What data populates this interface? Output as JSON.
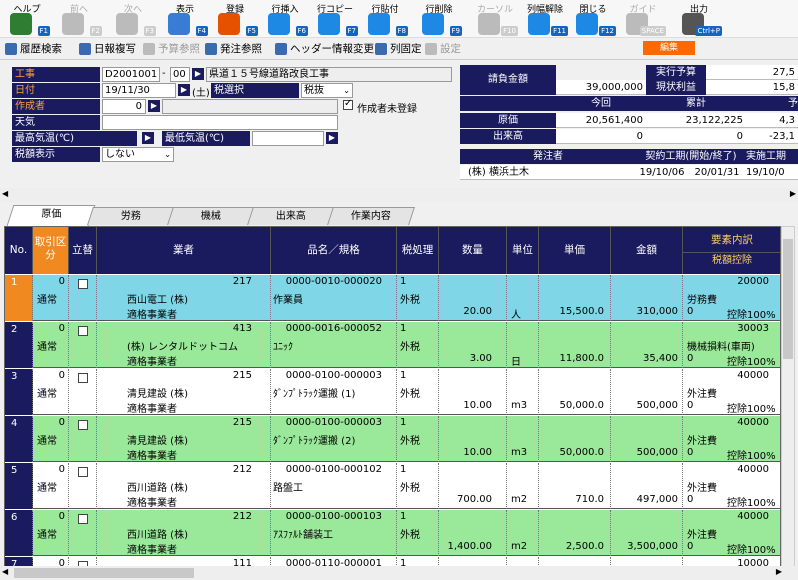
{
  "toolbar": [
    {
      "label": "ヘルプ",
      "key": "F1",
      "icon": "help-icon",
      "color": "#2e7d32",
      "dis": false
    },
    {
      "label": "前へ",
      "key": "F2",
      "icon": "arrow-left-icon",
      "color": "#bbb",
      "dis": true
    },
    {
      "label": "次へ",
      "key": "F3",
      "icon": "arrow-right-icon",
      "color": "#bbb",
      "dis": true
    },
    {
      "label": "表示",
      "key": "F4",
      "icon": "search-icon",
      "color": "#3a7bd5",
      "dis": false
    },
    {
      "label": "登録",
      "key": "F5",
      "icon": "ok-icon",
      "color": "#e65100",
      "dis": false
    },
    {
      "label": "行挿入",
      "key": "F6",
      "icon": "row-insert-icon",
      "color": "#1e88e5",
      "dis": false
    },
    {
      "label": "行コピー",
      "key": "F7",
      "icon": "row-copy-icon",
      "color": "#1e88e5",
      "dis": false
    },
    {
      "label": "行貼付",
      "key": "F8",
      "icon": "row-paste-icon",
      "color": "#1e88e5",
      "dis": false
    },
    {
      "label": "行削除",
      "key": "F9",
      "icon": "row-delete-icon",
      "color": "#1e88e5",
      "dis": false
    },
    {
      "label": "カーソル",
      "key": "F10",
      "icon": "cursor-icon",
      "color": "#bbb",
      "dis": true
    },
    {
      "label": "列幅解除",
      "key": "F11",
      "icon": "column-width-icon",
      "color": "#1e88e5",
      "dis": false
    },
    {
      "label": "閉じる",
      "key": "F12",
      "icon": "close-door-icon",
      "color": "#1e88e5",
      "dis": false
    },
    {
      "label": "ガイド",
      "key": "SPACE",
      "icon": "guide-bulb-icon",
      "color": "#bbb",
      "dis": true
    },
    {
      "label": "出力",
      "key": "Ctrl+P",
      "icon": "printer-icon",
      "color": "#555",
      "dis": false
    }
  ],
  "toolbar2": [
    {
      "label": "履歴検索",
      "icon": "history-search-icon",
      "dis": false
    },
    {
      "label": "日報複写",
      "icon": "daily-copy-icon",
      "dis": false
    },
    {
      "label": "予算参照",
      "icon": "budget-ref-icon",
      "dis": true
    },
    {
      "label": "発注参照",
      "icon": "order-ref-icon",
      "dis": false
    },
    {
      "label": "ヘッダー情報変更",
      "icon": "header-edit-icon",
      "dis": false
    },
    {
      "label": "列固定",
      "icon": "column-lock-icon",
      "dis": false
    },
    {
      "label": "設定",
      "icon": "settings-icon",
      "dis": true
    }
  ],
  "edit_badge": "編集",
  "form": {
    "koji_label": "工事",
    "koji_code": "D2001001",
    "koji_dash": "-",
    "koji_sub": "00",
    "koji_name": "県道１５号線道路改良工事",
    "date_label": "日付",
    "date": "19/11/30",
    "dow": "(土)",
    "tax_label": "税選択",
    "tax_value": "税抜",
    "author_label": "作成者",
    "author_code": "0",
    "unregistered": "作成者未登録",
    "weather_label": "天気",
    "weather": "",
    "max_temp_label": "最高気温(℃)",
    "min_temp_label": "最低気温(℃)",
    "taxdisp_label": "税額表示",
    "taxdisp_value": "しない"
  },
  "summary": {
    "ukeoi_label": "請負金額",
    "ukeoi": "39,000,000",
    "jikko_label": "実行予算",
    "jikko": "27,5",
    "genjo_label": "現状利益",
    "genjo": "15,8",
    "konkai": "今回",
    "ruikei": "累計",
    "yo": "予",
    "genka_label": "原価",
    "genka_now": "20,561,400",
    "genka_cum": "23,122,225",
    "genka_yo": "4,3",
    "deki_label": "出来高",
    "deki_now": "0",
    "deki_cum": "0",
    "deki_yo": "-23,1",
    "hacchu_label": "発注者",
    "keiyaku_label": "契約工期(開始/終了)",
    "jisshi_label": "実施工期",
    "hacchu": "(株) 横浜土木",
    "keiyaku_start": "19/10/06",
    "keiyaku_end": "20/01/31",
    "jisshi": "19/10/0"
  },
  "tabs": [
    "原価",
    "労務",
    "機械",
    "出来高",
    "作業内容"
  ],
  "columns": {
    "no": "No.",
    "kubun": "取引区分",
    "tatekae": "立替",
    "gyosha": "業者",
    "hinmei": "品名／規格",
    "zei": "税処理",
    "suryo": "数量",
    "tani": "単位",
    "tanka": "単価",
    "kingaku": "金額",
    "yoso": "要素内訳",
    "koujo": "税額控除"
  },
  "rows": [
    {
      "no": "1",
      "kcode": "0",
      "kubun": "通常",
      "vcode": "217",
      "vendor": "西山電工 (株)",
      "inv": "適格事業者",
      "pcode": "0000-0010-000020",
      "pname": "作業員",
      "zcode": "1",
      "zei": "外税",
      "qty": "20.00",
      "unit": "人",
      "price": "15,500.0",
      "amt": "310,000",
      "ecode": "20000",
      "elem": "労務費",
      "ep": "0",
      "epct": "控除100%"
    },
    {
      "no": "2",
      "kcode": "0",
      "kubun": "通常",
      "vcode": "413",
      "vendor": "(株) レンタルドットコム",
      "inv": "適格事業者",
      "pcode": "0000-0016-000052",
      "pname": "ﾕﾆｯｸ",
      "zcode": "1",
      "zei": "外税",
      "qty": "3.00",
      "unit": "日",
      "price": "11,800.0",
      "amt": "35,400",
      "ecode": "30003",
      "elem": "機械損料(車両)",
      "ep": "0",
      "epct": "控除100%"
    },
    {
      "no": "3",
      "kcode": "0",
      "kubun": "通常",
      "vcode": "215",
      "vendor": "清見建設 (株)",
      "inv": "適格事業者",
      "pcode": "0000-0100-000003",
      "pname": "ﾀﾞﾝﾌﾟﾄﾗｯｸ運搬 (1)",
      "zcode": "1",
      "zei": "外税",
      "qty": "10.00",
      "unit": "m3",
      "price": "50,000.0",
      "amt": "500,000",
      "ecode": "40000",
      "elem": "外注費",
      "ep": "0",
      "epct": "控除100%"
    },
    {
      "no": "4",
      "kcode": "0",
      "kubun": "通常",
      "vcode": "215",
      "vendor": "清見建設 (株)",
      "inv": "適格事業者",
      "pcode": "0000-0100-000003",
      "pname": "ﾀﾞﾝﾌﾟﾄﾗｯｸ運搬 (2)",
      "zcode": "1",
      "zei": "外税",
      "qty": "10.00",
      "unit": "m3",
      "price": "50,000.0",
      "amt": "500,000",
      "ecode": "40000",
      "elem": "外注費",
      "ep": "0",
      "epct": "控除100%"
    },
    {
      "no": "5",
      "kcode": "0",
      "kubun": "通常",
      "vcode": "212",
      "vendor": "西川道路 (株)",
      "inv": "適格事業者",
      "pcode": "0000-0100-000102",
      "pname": "路盤工",
      "zcode": "1",
      "zei": "外税",
      "qty": "700.00",
      "unit": "m2",
      "price": "710.0",
      "amt": "497,000",
      "ecode": "40000",
      "elem": "外注費",
      "ep": "0",
      "epct": "控除100%"
    },
    {
      "no": "6",
      "kcode": "0",
      "kubun": "通常",
      "vcode": "212",
      "vendor": "西川道路 (株)",
      "inv": "適格事業者",
      "pcode": "0000-0100-000103",
      "pname": "ｱｽﾌｧﾙﾄ舗装工",
      "zcode": "1",
      "zei": "外税",
      "qty": "1,400.00",
      "unit": "m2",
      "price": "2,500.0",
      "amt": "3,500,000",
      "ecode": "40000",
      "elem": "外注費",
      "ep": "0",
      "epct": "控除100%"
    },
    {
      "no": "7",
      "kcode": "0",
      "kubun": "",
      "vcode": "111",
      "vendor": "",
      "inv": "",
      "pcode": "0000-0110-000001",
      "pname": "",
      "zcode": "1",
      "zei": "",
      "qty": "",
      "unit": "",
      "price": "",
      "amt": "",
      "ecode": "10000",
      "elem": "",
      "ep": "",
      "epct": ""
    }
  ],
  "colors": {
    "navy": "#1a1a5e",
    "row_sel": "#7fd6e6",
    "row_green": "#9ae89a",
    "row_white": "#ffffff",
    "orange": "#f08a20"
  }
}
